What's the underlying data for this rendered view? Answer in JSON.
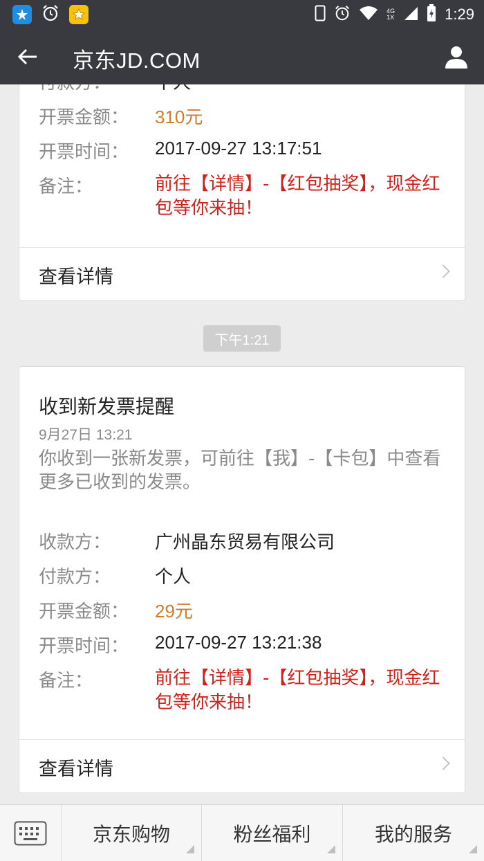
{
  "status_bar": {
    "time": "1:29",
    "network": "4G",
    "network_sub": "1X",
    "left_icons": [
      "qq-icon",
      "alarm-icon",
      "star-app-icon"
    ],
    "right_icons": [
      "phone-frame-icon",
      "alarm-icon",
      "wifi-icon",
      "signal-icon",
      "battery-icon"
    ]
  },
  "header": {
    "title": "京东JD.COM"
  },
  "message1": {
    "cut_label": "付款方：",
    "cut_value": "个人",
    "amount_label": "开票金额：",
    "amount_value": "310元",
    "time_label": "开票时间：",
    "time_value": "2017-09-27 13:17:51",
    "remark_label": "备注：",
    "remark_value": "前往【详情】-【红包抽奖】，现金红包等你来抽！",
    "detail_label": "查看详情"
  },
  "timestamp": "下午1:21",
  "message2": {
    "title": "收到新发票提醒",
    "date": "9月27日  13:21",
    "body": "你收到一张新发票，可前往【我】-【卡包】中查看更多已收到的发票。",
    "payee_label": "收款方：",
    "payee_value": "广州晶东贸易有限公司",
    "payer_label": "付款方：",
    "payer_value": "个人",
    "amount_label": "开票金额：",
    "amount_value": "29元",
    "time_label": "开票时间：",
    "time_value": "2017-09-27 13:21:38",
    "remark_label": "备注：",
    "remark_value": "前往【详情】-【红包抽奖】，现金红包等你来抽！",
    "detail_label": "查看详情"
  },
  "menu": {
    "items": [
      "京东购物",
      "粉丝福利",
      "我的服务"
    ]
  },
  "colors": {
    "bar": "#393a3f",
    "amount": "#d47b2a",
    "remark": "#d0221b"
  }
}
